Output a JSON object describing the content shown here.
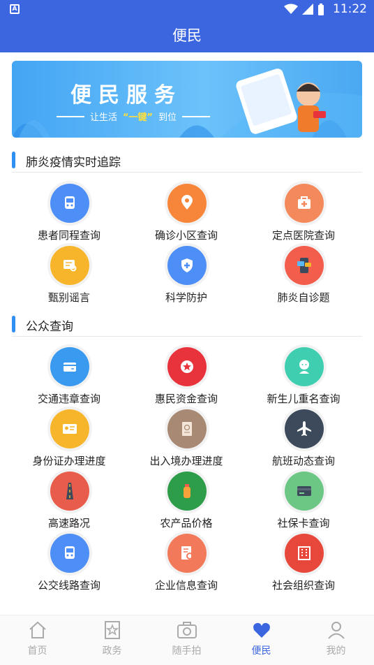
{
  "status": {
    "time": "11:22"
  },
  "header": {
    "title": "便民"
  },
  "banner": {
    "title": "便民服务",
    "sub_before": "让生活",
    "sub_highlight": "“一键”",
    "sub_after": "到位"
  },
  "sections": [
    {
      "title": "肺炎疫情实时追踪"
    },
    {
      "title": "公众查询"
    }
  ],
  "epidemic_items": [
    {
      "label": "患者同程查询",
      "icon": "train-icon",
      "color": "#4d8ef7"
    },
    {
      "label": "确诊小区查询",
      "icon": "location-pin-icon",
      "color": "#f7853a"
    },
    {
      "label": "定点医院查询",
      "icon": "medical-kit-icon",
      "color": "#f48a5c"
    },
    {
      "label": "甄别谣言",
      "icon": "message-search-icon",
      "color": "#f7b52c"
    },
    {
      "label": "科学防护",
      "icon": "shield-plus-icon",
      "color": "#4d8ef7"
    },
    {
      "label": "肺炎自诊题",
      "icon": "phone-chat-icon",
      "color": "#f35d4c"
    }
  ],
  "public_items": [
    {
      "label": "交通违章查询",
      "icon": "traffic-ticket-icon",
      "color": "#3a9af0"
    },
    {
      "label": "惠民资金查询",
      "icon": "medal-star-icon",
      "color": "#e8333c"
    },
    {
      "label": "新生儿重名查询",
      "icon": "baby-icon",
      "color": "#3fcfb0"
    },
    {
      "label": "身份证办理进度",
      "icon": "id-card-icon",
      "color": "#f7b52c"
    },
    {
      "label": "出入境办理进度",
      "icon": "passport-icon",
      "color": "#a88a74"
    },
    {
      "label": "航班动态查询",
      "icon": "airplane-icon",
      "color": "#3d4a5c"
    },
    {
      "label": "高速路况",
      "icon": "highway-icon",
      "color": "#e85c4c"
    },
    {
      "label": "农产品价格",
      "icon": "oil-bottle-icon",
      "color": "#2e9d4a"
    },
    {
      "label": "社保卡查询",
      "icon": "bank-card-icon",
      "color": "#6cc784"
    },
    {
      "label": "公交线路查询",
      "icon": "bus-icon",
      "color": "#4d8ef7"
    },
    {
      "label": "企业信息查询",
      "icon": "document-search-icon",
      "color": "#f27a5a"
    },
    {
      "label": "社会组织查询",
      "icon": "building-grid-icon",
      "color": "#e8473c"
    }
  ],
  "tabs": [
    {
      "label": "首页",
      "icon": "home-icon",
      "active": false
    },
    {
      "label": "政务",
      "icon": "star-doc-icon",
      "active": false
    },
    {
      "label": "随手拍",
      "icon": "camera-icon",
      "active": false
    },
    {
      "label": "便民",
      "icon": "heart-hand-icon",
      "active": true
    },
    {
      "label": "我的",
      "icon": "person-icon",
      "active": false
    }
  ],
  "colors": {
    "primary": "#3c66df",
    "accent_bar": "#2f8ff2",
    "tab_inactive": "#aaaaaa"
  }
}
